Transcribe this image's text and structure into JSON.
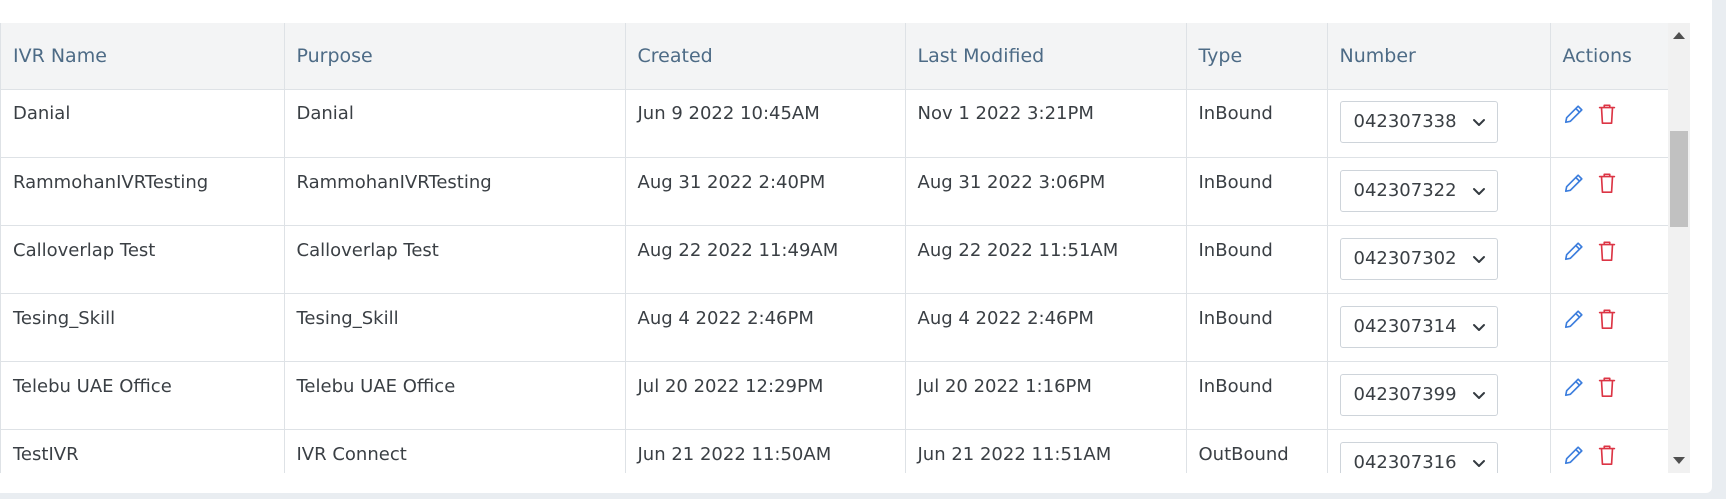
{
  "table": {
    "headers": [
      "IVR Name",
      "Purpose",
      "Created",
      "Last Modified",
      "Type",
      "Number",
      "Actions"
    ],
    "rows": [
      {
        "name": "Danial",
        "purpose": "Danial",
        "created": "Jun 9 2022 10:45AM",
        "modified": "Nov 1 2022 3:21PM",
        "type": "InBound",
        "number": "042307338"
      },
      {
        "name": "RammohanIVRTesting",
        "purpose": "RammohanIVRTesting",
        "created": "Aug 31 2022 2:40PM",
        "modified": "Aug 31 2022 3:06PM",
        "type": "InBound",
        "number": "042307322"
      },
      {
        "name": "Calloverlap Test",
        "purpose": "Calloverlap Test",
        "created": "Aug 22 2022 11:49AM",
        "modified": "Aug 22 2022 11:51AM",
        "type": "InBound",
        "number": "042307302"
      },
      {
        "name": "Tesing_Skill",
        "purpose": "Tesing_Skill",
        "created": "Aug 4 2022 2:46PM",
        "modified": "Aug 4 2022 2:46PM",
        "type": "InBound",
        "number": "042307314"
      },
      {
        "name": "Telebu UAE Office",
        "purpose": "Telebu UAE Office",
        "created": "Jul 20 2022 12:29PM",
        "modified": "Jul 20 2022 1:16PM",
        "type": "InBound",
        "number": "042307399"
      },
      {
        "name": "TestIVR",
        "purpose": "IVR Connect",
        "created": "Jun 21 2022 11:50AM",
        "modified": "Jun 21 2022 11:51AM",
        "type": "OutBound",
        "number": "042307316"
      }
    ]
  },
  "icons": {
    "edit": "pencil-icon",
    "delete": "trash-icon",
    "dropdown": "chevron-down-icon"
  },
  "colors": {
    "header_text": "#4d6b86",
    "header_bg": "#f3f4f5",
    "edit_icon": "#3b7ddd",
    "delete_icon": "#dc3545",
    "border": "#dee2e6"
  }
}
